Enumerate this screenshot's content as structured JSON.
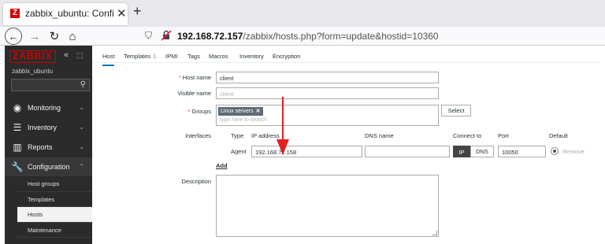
{
  "browser": {
    "tab_title": "zabbix_ubuntu: Configur",
    "tab_favicon": "Z",
    "url_prefix": "",
    "url_host": "192.168.72.157",
    "url_path": "/zabbix/hosts.php?form=update&hostid=10360"
  },
  "sidebar": {
    "logo": "ZABBIX",
    "server_name": "zabbix_ubuntu",
    "search_value": "",
    "menu": [
      {
        "label": "Monitoring",
        "icon": "eye-icon"
      },
      {
        "label": "Inventory",
        "icon": "list-icon"
      },
      {
        "label": "Reports",
        "icon": "bar-chart-icon"
      },
      {
        "label": "Configuration",
        "icon": "wrench-icon"
      }
    ],
    "submenu": [
      {
        "label": "Host groups"
      },
      {
        "label": "Templates"
      },
      {
        "label": "Hosts"
      },
      {
        "label": "Maintenance"
      }
    ]
  },
  "tabs": [
    {
      "label": "Host",
      "badge": ""
    },
    {
      "label": "Templates",
      "badge": "1"
    },
    {
      "label": "IPMI",
      "badge": ""
    },
    {
      "label": "Tags",
      "badge": ""
    },
    {
      "label": "Macros",
      "badge": ""
    },
    {
      "label": "Inventory",
      "badge": ""
    },
    {
      "label": "Encryption",
      "badge": ""
    }
  ],
  "form": {
    "host_name_label": "Host name",
    "host_name_value": "client",
    "visible_name_label": "Visible name",
    "visible_name_placeholder": "client",
    "groups_label": "Groups",
    "group_chip": "Linux servers",
    "groups_placeholder": "type here to search",
    "select_button": "Select",
    "interfaces_label": "Interfaces",
    "interface_headers": {
      "type": "Type",
      "ip": "IP address",
      "dns": "DNS name",
      "connect": "Connect to",
      "port": "Port",
      "default": "Default"
    },
    "agent_label": "Agent",
    "agent_ip": "192.168.72.158",
    "agent_dns": "",
    "connect_ip": "IP",
    "connect_dns": "DNS",
    "port": "10050",
    "remove_link": "Remove",
    "add_link": "Add",
    "description_label": "Description",
    "description_value": ""
  },
  "colors": {
    "accent": "#0275b8",
    "brand_red": "#d40000",
    "sidebar_bg": "#2b2b2b",
    "annotation_arrow": "#e02020"
  }
}
